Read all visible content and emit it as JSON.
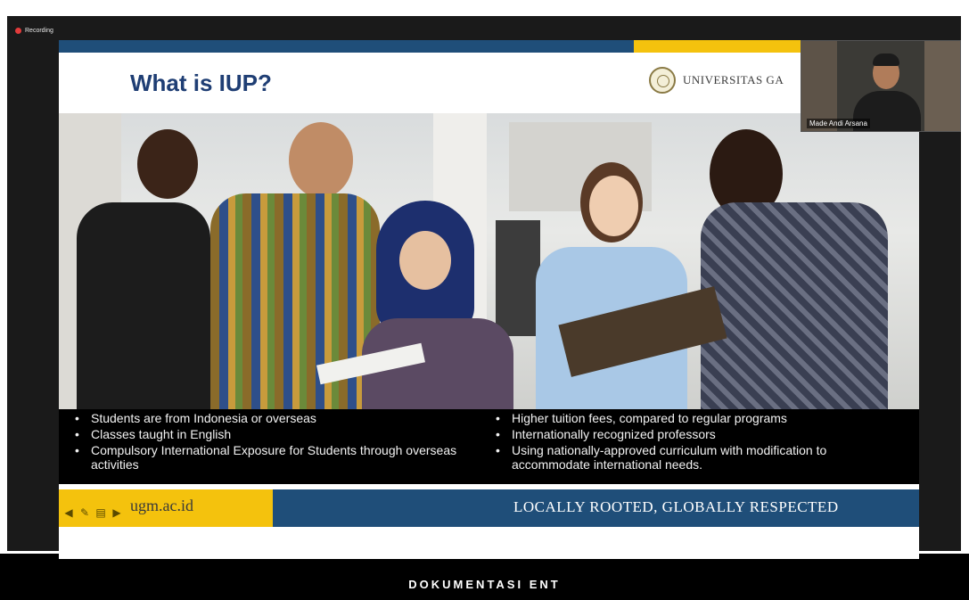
{
  "recording": {
    "label": "Recording"
  },
  "slide": {
    "title": "What is IUP?",
    "university": "UNIVERSITAS GA",
    "bullets_left": [
      "Students are from Indonesia or overseas",
      "Classes taught in English",
      "Compulsory International Exposure for Students through overseas activities"
    ],
    "bullets_right": [
      "Higher tuition fees, compared to regular programs",
      "Internationally recognized professors",
      "Using nationally-approved curriculum with modification to accommodate international needs."
    ],
    "footer_site": "ugm.ac.id",
    "footer_slogan": "LOCALLY ROOTED, GLOBALLY RESPECTED",
    "colors": {
      "navy": "#1f4e79",
      "gold": "#f4c20d",
      "title": "#1f3e74"
    }
  },
  "toolbar_icons": [
    "arrow-left-icon",
    "pen-icon",
    "slides-icon",
    "arrow-right-icon"
  ],
  "webcam": {
    "participant_name": "Made Andi Arsana"
  },
  "caption": "DOKUMENTASI ENT"
}
